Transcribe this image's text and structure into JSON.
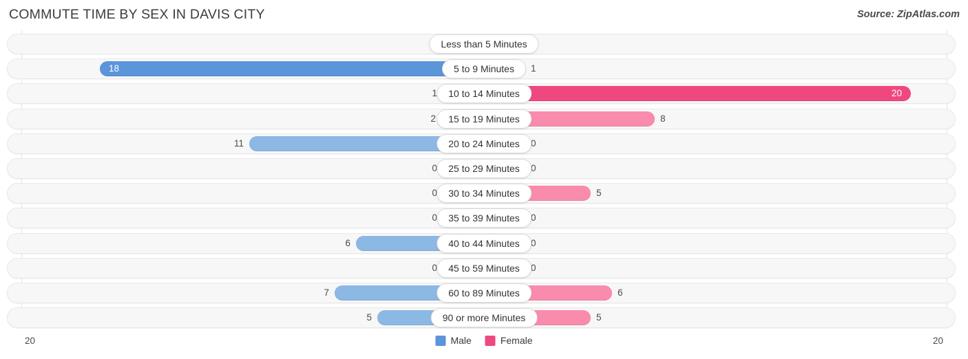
{
  "header": {
    "title": "COMMUTE TIME BY SEX IN DAVIS CITY",
    "source": "Source: ZipAtlas.com"
  },
  "axis": {
    "left_label": "20",
    "right_label": "20"
  },
  "legend": {
    "male_label": "Male",
    "female_label": "Female",
    "male_color": "#5b95da",
    "female_color": "#ef487f"
  },
  "chart_data": {
    "type": "bar",
    "title": "COMMUTE TIME BY SEX IN DAVIS CITY",
    "subtitle": "Source: ZipAtlas.com",
    "orientation": "horizontal-diverging",
    "xlabel": "",
    "ylabel": "",
    "xlim": [
      20,
      20
    ],
    "grid": true,
    "legend_position": "bottom-center",
    "categories": [
      "Less than 5 Minutes",
      "5 to 9 Minutes",
      "10 to 14 Minutes",
      "15 to 19 Minutes",
      "20 to 24 Minutes",
      "25 to 29 Minutes",
      "30 to 34 Minutes",
      "35 to 39 Minutes",
      "40 to 44 Minutes",
      "45 to 59 Minutes",
      "60 to 89 Minutes",
      "90 or more Minutes"
    ],
    "series": [
      {
        "name": "Male",
        "direction": "left",
        "color": "#8cb8e4",
        "max_color": "#5b95da",
        "values": [
          0,
          18,
          1,
          2,
          11,
          0,
          0,
          0,
          6,
          0,
          7,
          5
        ],
        "labels": [
          "0",
          "18",
          "1",
          "2",
          "11",
          "0",
          "0",
          "0",
          "6",
          "0",
          "7",
          "5"
        ]
      },
      {
        "name": "Female",
        "direction": "right",
        "color": "#f98bac",
        "max_color": "#ef487f",
        "values": [
          0,
          1,
          20,
          8,
          0,
          0,
          5,
          0,
          0,
          0,
          6,
          5
        ],
        "labels": [
          "0",
          "1",
          "20",
          "8",
          "0",
          "0",
          "5",
          "0",
          "0",
          "0",
          "6",
          "5"
        ]
      }
    ]
  }
}
